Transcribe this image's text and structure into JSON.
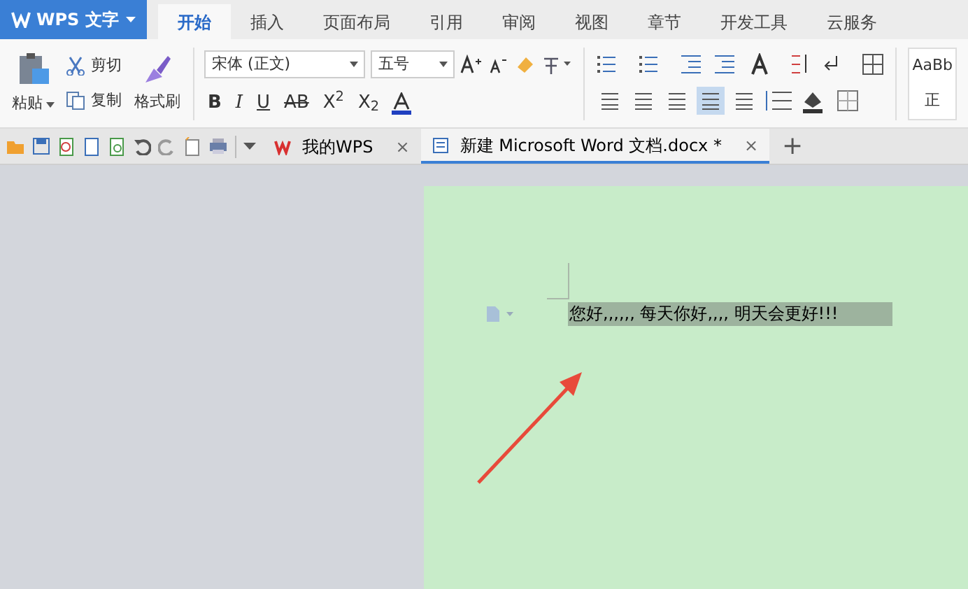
{
  "app_menu": {
    "title": "WPS 文字"
  },
  "ribbon_tabs": [
    {
      "label": "开始",
      "selected": true
    },
    {
      "label": "插入",
      "selected": false
    },
    {
      "label": "页面布局",
      "selected": false
    },
    {
      "label": "引用",
      "selected": false
    },
    {
      "label": "审阅",
      "selected": false
    },
    {
      "label": "视图",
      "selected": false
    },
    {
      "label": "章节",
      "selected": false
    },
    {
      "label": "开发工具",
      "selected": false
    },
    {
      "label": "云服务",
      "selected": false
    }
  ],
  "clipboard": {
    "paste": "粘贴",
    "cut": "剪切",
    "copy": "复制",
    "format_painter": "格式刷"
  },
  "font": {
    "name": "宋体 (正文)",
    "size": "五号"
  },
  "font_buttons": [
    "B",
    "I",
    "U",
    "AB",
    "X$^{2}$",
    "X$_{2}$"
  ],
  "align_buttons": [
    {
      "selected": false
    },
    {
      "selected": false
    },
    {
      "selected": false
    },
    {
      "selected": true
    },
    {
      "selected": false
    }
  ],
  "styles": {
    "preview": "AaBb",
    "name": "正"
  },
  "doc_tabs": [
    {
      "label": "我的WPS",
      "close": "×",
      "selected": false
    },
    {
      "label": "新建 Microsoft Word 文档.docx *",
      "close": "×",
      "selected": true
    }
  ],
  "new_tab": "+",
  "document": {
    "text": "您好,,,,,, 每天你好,,,, 明天会更好!!!",
    "selected": true
  }
}
